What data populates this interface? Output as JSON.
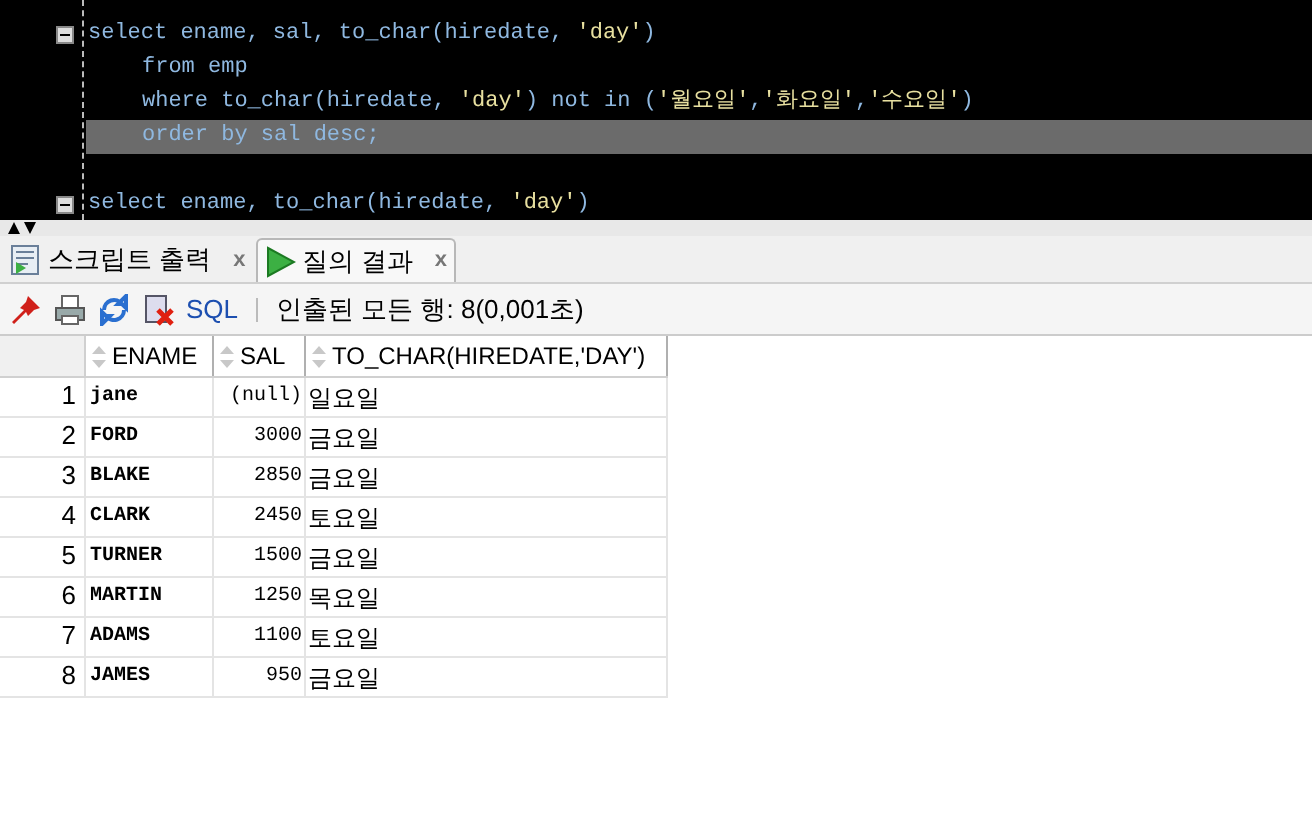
{
  "editor": {
    "statements": [
      {
        "highlighted": false,
        "segments": [
          {
            "kind": "code",
            "text": "select ename, sal, to_char(hiredate, "
          },
          {
            "kind": "string",
            "text": "'day'"
          },
          {
            "kind": "code",
            "text": ")"
          }
        ],
        "children": [
          {
            "highlighted": false,
            "segments": [
              {
                "kind": "code",
                "text": "from emp"
              }
            ]
          },
          {
            "highlighted": false,
            "segments": [
              {
                "kind": "code",
                "text": "where to_char(hiredate, "
              },
              {
                "kind": "string",
                "text": "'day'"
              },
              {
                "kind": "code",
                "text": ") not in ("
              },
              {
                "kind": "string",
                "text": "'월요일'"
              },
              {
                "kind": "code",
                "text": ","
              },
              {
                "kind": "string",
                "text": "'화요일'"
              },
              {
                "kind": "code",
                "text": ","
              },
              {
                "kind": "string",
                "text": "'수요일'"
              },
              {
                "kind": "code",
                "text": ")"
              }
            ]
          },
          {
            "highlighted": true,
            "segments": [
              {
                "kind": "code",
                "text": "order by sal desc;"
              }
            ]
          }
        ]
      },
      {
        "highlighted": false,
        "segments": [
          {
            "kind": "code",
            "text": "select ename, to_char(hiredate, "
          },
          {
            "kind": "string",
            "text": "'day'"
          },
          {
            "kind": "code",
            "text": ")"
          }
        ]
      }
    ]
  },
  "tabs": [
    {
      "label": "스크립트 출력",
      "selected": false,
      "close": "x"
    },
    {
      "label": "질의 결과",
      "selected": true,
      "close": "x"
    }
  ],
  "toolbar": {
    "sql_label": "SQL",
    "status": "인출된 모든 행: 8(0,001초)"
  },
  "table": {
    "columns": [
      "ENAME",
      "SAL",
      "TO_CHAR(HIREDATE,'DAY')"
    ],
    "rows": [
      {
        "num": "1",
        "cells": [
          "jane",
          "(null)",
          "일요일"
        ]
      },
      {
        "num": "2",
        "cells": [
          "FORD",
          "3000",
          "금요일"
        ]
      },
      {
        "num": "3",
        "cells": [
          "BLAKE",
          "2850",
          "금요일"
        ]
      },
      {
        "num": "4",
        "cells": [
          "CLARK",
          "2450",
          "토요일"
        ]
      },
      {
        "num": "5",
        "cells": [
          "TURNER",
          "1500",
          "금요일"
        ]
      },
      {
        "num": "6",
        "cells": [
          "MARTIN",
          "1250",
          "목요일"
        ]
      },
      {
        "num": "7",
        "cells": [
          "ADAMS",
          "1100",
          "토요일"
        ]
      },
      {
        "num": "8",
        "cells": [
          "JAMES",
          "950",
          "금요일"
        ]
      }
    ]
  }
}
